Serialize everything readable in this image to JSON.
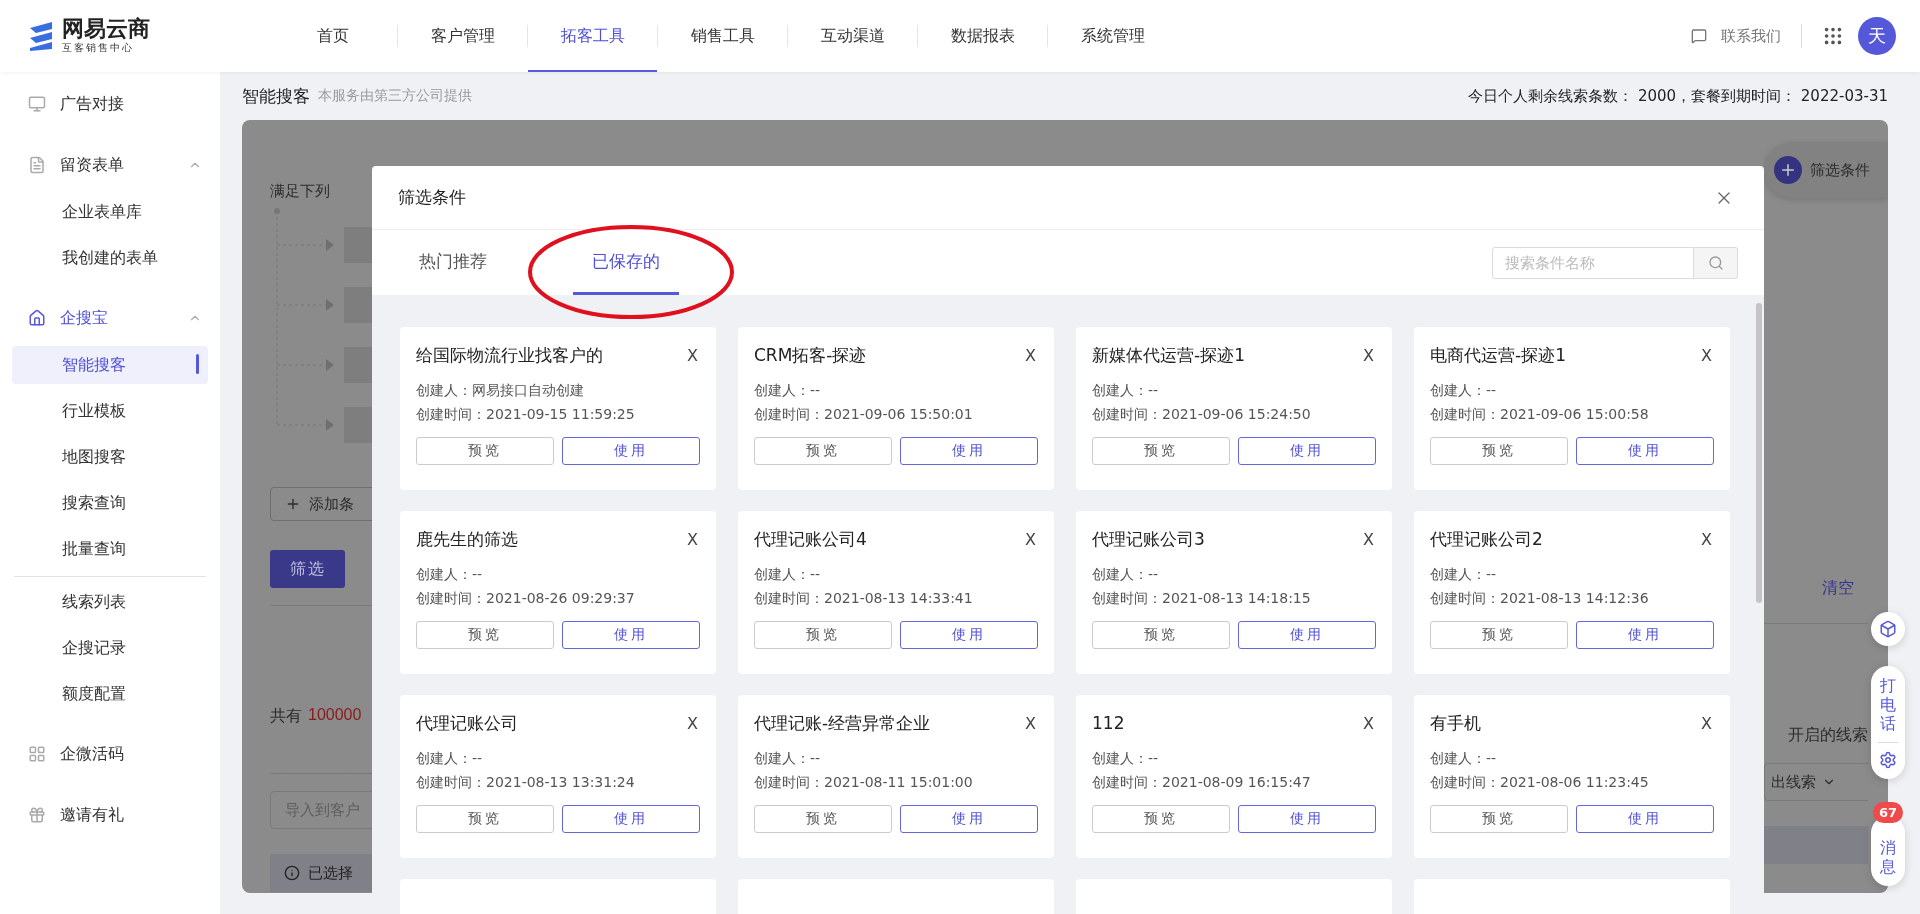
{
  "nav": {
    "logo": "网易云商",
    "logo_sub": "互客销售中心",
    "items": [
      {
        "label": "首页",
        "selected": false
      },
      {
        "label": "客户管理",
        "selected": false
      },
      {
        "label": "拓客工具",
        "selected": true
      },
      {
        "label": "销售工具",
        "selected": false
      },
      {
        "label": "互动渠道",
        "selected": false
      },
      {
        "label": "数据报表",
        "selected": false
      },
      {
        "label": "系统管理",
        "selected": false
      }
    ],
    "contact": "联系我们",
    "avatar": "天"
  },
  "sidebar": {
    "items": [
      {
        "label": "广告对接",
        "active": false
      },
      {
        "label": "留资表单",
        "active": false,
        "expanded": true,
        "children": [
          {
            "label": "企业表单库",
            "selected": false,
            "divider_before": false
          },
          {
            "label": "我创建的表单",
            "selected": false,
            "divider_before": false
          }
        ]
      },
      {
        "label": "企搜宝",
        "active": true,
        "expanded": true,
        "children": [
          {
            "label": "智能搜客",
            "selected": true,
            "divider_before": false
          },
          {
            "label": "行业模板",
            "selected": false,
            "divider_before": false
          },
          {
            "label": "地图搜客",
            "selected": false,
            "divider_before": false
          },
          {
            "label": "搜索查询",
            "selected": false,
            "divider_before": false
          },
          {
            "label": "批量查询",
            "selected": false,
            "divider_before": false
          },
          {
            "label": "线索列表",
            "selected": false,
            "divider_before": true
          },
          {
            "label": "企搜记录",
            "selected": false,
            "divider_before": false
          },
          {
            "label": "额度配置",
            "selected": false,
            "divider_before": false
          }
        ]
      },
      {
        "label": "企微活码",
        "active": false
      },
      {
        "label": "邀请有礼",
        "active": false
      }
    ]
  },
  "header": {
    "title": "智能搜客",
    "subtitle": "本服务由第三方公司提供",
    "quota": "今日个人剩余线索条数：  2000，套餐到期时间：  2022-03-31"
  },
  "background": {
    "conditions_label": "满足下列",
    "add_button": "添加条",
    "filter_button": "筛选",
    "total_label": "共有",
    "total_value": "100000",
    "import_placeholder": "导入到客户",
    "selected_label": "已选择",
    "filter_pill": "筛选条件",
    "clear": "清空",
    "opened_text": "开启的线索",
    "export_button": "出线索"
  },
  "modal": {
    "title": "筛选条件",
    "tabs": [
      {
        "label": "热门推荐",
        "selected": false
      },
      {
        "label": "已保存的",
        "selected": true
      }
    ],
    "search": {
      "placeholder": "搜索条件名称"
    },
    "cards": [
      {
        "title": "给国际物流行业找客户的",
        "close": "X",
        "creator": "创建人：网易接口自动创建",
        "created": "创建时间：2021-09-15 11:59:25",
        "preview": "预览",
        "use": "使用"
      },
      {
        "title": "CRM拓客-探迹",
        "close": "X",
        "creator": "创建人：--",
        "created": "创建时间：2021-09-06 15:50:01",
        "preview": "预览",
        "use": "使用"
      },
      {
        "title": "新媒体代运营-探迹1",
        "close": "X",
        "creator": "创建人：--",
        "created": "创建时间：2021-09-06 15:24:50",
        "preview": "预览",
        "use": "使用"
      },
      {
        "title": "电商代运营-探迹1",
        "close": "X",
        "creator": "创建人：--",
        "created": "创建时间：2021-09-06 15:00:58",
        "preview": "预览",
        "use": "使用"
      },
      {
        "title": "鹿先生的筛选",
        "close": "X",
        "creator": "创建人：--",
        "created": "创建时间：2021-08-26 09:29:37",
        "preview": "预览",
        "use": "使用"
      },
      {
        "title": "代理记账公司4",
        "close": "X",
        "creator": "创建人：--",
        "created": "创建时间：2021-08-13 14:33:41",
        "preview": "预览",
        "use": "使用"
      },
      {
        "title": "代理记账公司3",
        "close": "X",
        "creator": "创建人：--",
        "created": "创建时间：2021-08-13 14:18:15",
        "preview": "预览",
        "use": "使用"
      },
      {
        "title": "代理记账公司2",
        "close": "X",
        "creator": "创建人：--",
        "created": "创建时间：2021-08-13 14:12:36",
        "preview": "预览",
        "use": "使用"
      },
      {
        "title": "代理记账公司",
        "close": "X",
        "creator": "创建人：--",
        "created": "创建时间：2021-08-13 13:31:24",
        "preview": "预览",
        "use": "使用"
      },
      {
        "title": "代理记账-经营异常企业",
        "close": "X",
        "creator": "创建人：--",
        "created": "创建时间：2021-08-11 15:01:00",
        "preview": "预览",
        "use": "使用"
      },
      {
        "title": "112",
        "close": "X",
        "creator": "创建人：--",
        "created": "创建时间：2021-08-09 16:15:47",
        "preview": "预览",
        "use": "使用"
      },
      {
        "title": "有手机",
        "close": "X",
        "creator": "创建人：--",
        "created": "创建时间：2021-08-06 11:23:45",
        "preview": "预览",
        "use": "使用"
      }
    ]
  },
  "floating": {
    "call": "打电话",
    "messages": "消息",
    "badge": "67"
  }
}
